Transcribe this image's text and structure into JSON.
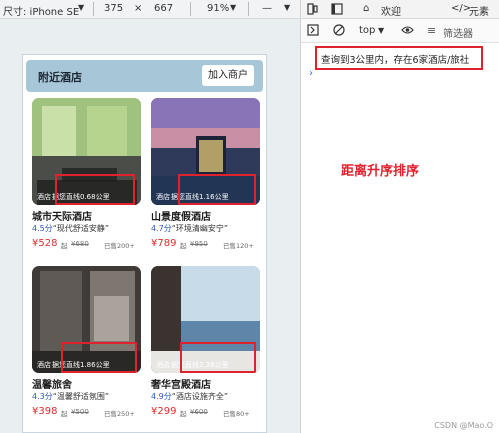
{
  "device_toolbar": {
    "size_label": "尺寸: iPhone SE",
    "width": "375",
    "height": "667",
    "zoom": "91%"
  },
  "devtools": {
    "tabs": [
      "欢迎",
      "元素"
    ],
    "context": "top",
    "filter_placeholder": "筛选器",
    "log_message": "查询到3公里内，存在6家酒店/旅社",
    "annotation": "距离升序排序",
    "watermark": "CSDN @Mao.O"
  },
  "page": {
    "title": "附近酒店",
    "add_button": "加入商户"
  },
  "hotels": [
    {
      "tag": "酒店",
      "distance": "据您直线0.68公里",
      "name": "城市天际酒店",
      "rating": "4.5分",
      "slogan": "“现代舒适安静”",
      "price": "¥528",
      "unit": "起",
      "old_price": "¥680",
      "sold": "已售200+"
    },
    {
      "tag": "酒店",
      "distance": "据您直线1.16公里",
      "name": "山景度假酒店",
      "rating": "4.7分",
      "slogan": "“环境清幽安宁”",
      "price": "¥789",
      "unit": "起",
      "old_price": "¥950",
      "sold": "已售120+"
    },
    {
      "tag": "酒店",
      "distance": "据您直线1.86公里",
      "name": "温馨旅舍",
      "rating": "4.3分",
      "slogan": "“温馨舒适氛围”",
      "price": "¥398",
      "unit": "起",
      "old_price": "¥500",
      "sold": "已售250+"
    },
    {
      "tag": "酒店",
      "distance": "据您直线2.38公里",
      "name": "奢华宫殿酒店",
      "rating": "4.9分",
      "slogan": "“酒店设施齐全”",
      "price": "¥299",
      "unit": "起",
      "old_price": "¥600",
      "sold": "已售80+"
    }
  ]
}
